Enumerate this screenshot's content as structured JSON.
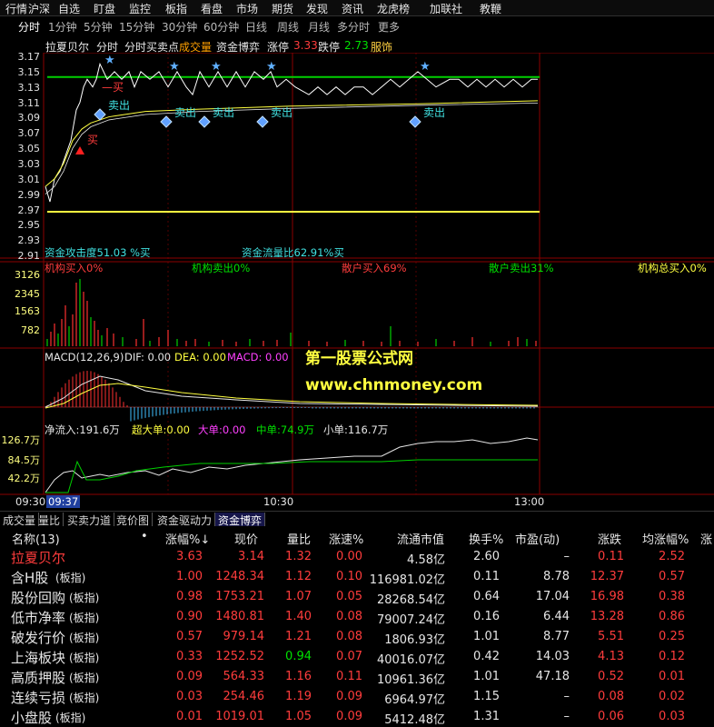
{
  "menu": [
    "行情",
    "沪深",
    "自选",
    "盯盘",
    "监控",
    "板指",
    "看盘",
    "市场",
    "期货",
    "发现",
    "资讯",
    "龙虎榜",
    "加联社",
    "教鞭"
  ],
  "periods": [
    "分时",
    "1分钟",
    "5分钟",
    "15分钟",
    "30分钟",
    "60分钟",
    "日线",
    "周线",
    "月线",
    "多分时",
    "更多"
  ],
  "info": {
    "name": "拉夏贝尔",
    "mode": "分时",
    "indicator": "分时买卖点",
    "tags": [
      "成交量",
      "资金博弈"
    ],
    "limit_up_label": "涨停",
    "limit_up_value": "3.33",
    "limit_down_label": "跌停",
    "limit_down_value": "2.73",
    "industry": "服饰"
  },
  "price_axis": [
    "3.17",
    "3.15",
    "3.13",
    "3.11",
    "3.09",
    "3.07",
    "3.05",
    "3.03",
    "3.01",
    "2.99",
    "2.97",
    "2.95",
    "2.93",
    "2.91"
  ],
  "signals": {
    "sell": "卖出",
    "buy": "买"
  },
  "attack_text": "资金攻击度51.03 %买",
  "flow_ratio_text": "资金流量比62.91%买",
  "flow_stats": [
    {
      "text": "机构买入0%",
      "color": "#ff3c3c"
    },
    {
      "text": "机构卖出0%",
      "color": "#00e000"
    },
    {
      "text": "散户买入69%",
      "color": "#ff3c3c"
    },
    {
      "text": "散户卖出31%",
      "color": "#00e000"
    },
    {
      "text": "机构总买入0%",
      "color": "#ffff40"
    }
  ],
  "volume_axis": [
    "3126",
    "2345",
    "1563",
    "782"
  ],
  "macd": {
    "title": "MACD(12,26,9)",
    "dif": "DIF: 0.00",
    "dea": "DEA: 0.00",
    "macd": "MACD: 0.00"
  },
  "watermark": {
    "line1": "第一股票公式网",
    "line2": "www.chnmoney.com"
  },
  "netflow": {
    "net": "净流入:191.6万",
    "super": "超大单:0.00",
    "big": "大单:0.00",
    "mid": "中单:74.9万",
    "small": "小单:116.7万"
  },
  "netflow_axis": [
    "126.7万",
    "84.5万",
    "42.2万"
  ],
  "time_axis": [
    "09:30",
    "09:37",
    "10:30",
    "13:00"
  ],
  "tabs": [
    "成交量",
    "量比",
    "买卖力道",
    "竞价图",
    "资金驱动力",
    "资金博弈"
  ],
  "table": {
    "headers": [
      "名称(13)",
      "•",
      "涨幅%↓",
      "现价",
      "量比",
      "涨速%",
      "流通市值",
      "换手%",
      "市盈(动)",
      "涨跌",
      "均涨幅%",
      "涨"
    ],
    "rows": [
      {
        "name": "拉夏贝尔",
        "tag": "",
        "chg": "3.63",
        "price": "3.14",
        "vr": "1.32",
        "speed": "0.00",
        "cap": "4.58亿",
        "turn": "2.60",
        "pe": "–",
        "diff": "0.11",
        "avg": "2.52"
      },
      {
        "name": "含H股",
        "tag": "(板指)",
        "chg": "1.00",
        "price": "1248.34",
        "vr": "1.12",
        "speed": "0.10",
        "cap": "116981.02亿",
        "turn": "0.11",
        "pe": "8.78",
        "diff": "12.37",
        "avg": "0.57"
      },
      {
        "name": "股份回购",
        "tag": "(板指)",
        "chg": "0.98",
        "price": "1753.21",
        "vr": "1.07",
        "speed": "0.05",
        "cap": "28268.54亿",
        "turn": "0.64",
        "pe": "17.04",
        "diff": "16.98",
        "avg": "0.38"
      },
      {
        "name": "低市净率",
        "tag": "(板指)",
        "chg": "0.90",
        "price": "1480.81",
        "vr": "1.40",
        "speed": "0.08",
        "cap": "79007.24亿",
        "turn": "0.16",
        "pe": "6.44",
        "diff": "13.28",
        "avg": "0.86"
      },
      {
        "name": "破发行价",
        "tag": "(板指)",
        "chg": "0.57",
        "price": "979.14",
        "vr": "1.21",
        "speed": "0.08",
        "cap": "1806.93亿",
        "turn": "1.01",
        "pe": "8.77",
        "diff": "5.51",
        "avg": "0.25"
      },
      {
        "name": "上海板块",
        "tag": "(板指)",
        "chg": "0.33",
        "price": "1252.52",
        "vr": "0.94",
        "speed": "0.07",
        "cap": "40016.07亿",
        "turn": "0.42",
        "pe": "14.03",
        "diff": "4.13",
        "avg": "0.12"
      },
      {
        "name": "高质押股",
        "tag": "(板指)",
        "chg": "0.09",
        "price": "564.33",
        "vr": "1.16",
        "speed": "0.11",
        "cap": "10961.36亿",
        "turn": "1.01",
        "pe": "47.18",
        "diff": "0.52",
        "avg": "0.01"
      },
      {
        "name": "连续亏损",
        "tag": "(板指)",
        "chg": "0.03",
        "price": "254.46",
        "vr": "1.19",
        "speed": "0.09",
        "cap": "6964.97亿",
        "turn": "1.15",
        "pe": "–",
        "diff": "0.08",
        "avg": "0.02"
      },
      {
        "name": "小盘股",
        "tag": "(板指)",
        "chg": "0.01",
        "price": "1019.01",
        "vr": "1.05",
        "speed": "0.09",
        "cap": "5412.48亿",
        "turn": "1.31",
        "pe": "–",
        "diff": "0.06",
        "avg": "0.03"
      }
    ]
  },
  "colors": {
    "up": "#ff3c3c",
    "down": "#00e000",
    "grid": "#8b0000",
    "yellow": "#ffff40",
    "cyan": "#40e0e0",
    "magenta": "#ff40ff"
  }
}
